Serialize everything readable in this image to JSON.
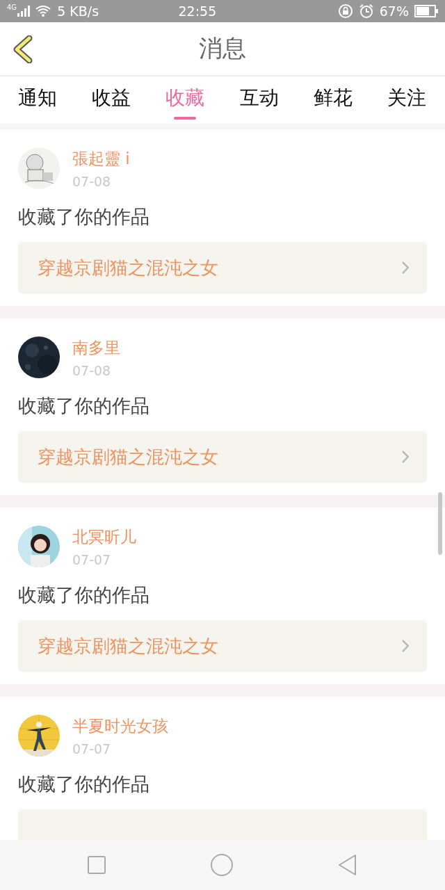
{
  "status_bar": {
    "network": "4G",
    "speed": "5 KB/s",
    "time": "22:55",
    "battery": "67%"
  },
  "header": {
    "title": "消息"
  },
  "tabs": [
    {
      "label": "通知",
      "selected": false
    },
    {
      "label": "收益",
      "selected": false
    },
    {
      "label": "收藏",
      "selected": true
    },
    {
      "label": "互动",
      "selected": false
    },
    {
      "label": "鲜花",
      "selected": false
    },
    {
      "label": "关注",
      "selected": false
    }
  ],
  "messages": [
    {
      "user": "張起靈 i",
      "date": "07-08",
      "action": "收藏了你的作品",
      "work": "穿越京剧猫之混沌之女"
    },
    {
      "user": "南多里",
      "date": "07-08",
      "action": "收藏了你的作品",
      "work": "穿越京剧猫之混沌之女"
    },
    {
      "user": "北冥昕儿",
      "date": "07-07",
      "action": "收藏了你的作品",
      "work": "穿越京剧猫之混沌之女"
    },
    {
      "user": "半夏时光女孩",
      "date": "07-07",
      "action": "收藏了你的作品"
    }
  ]
}
